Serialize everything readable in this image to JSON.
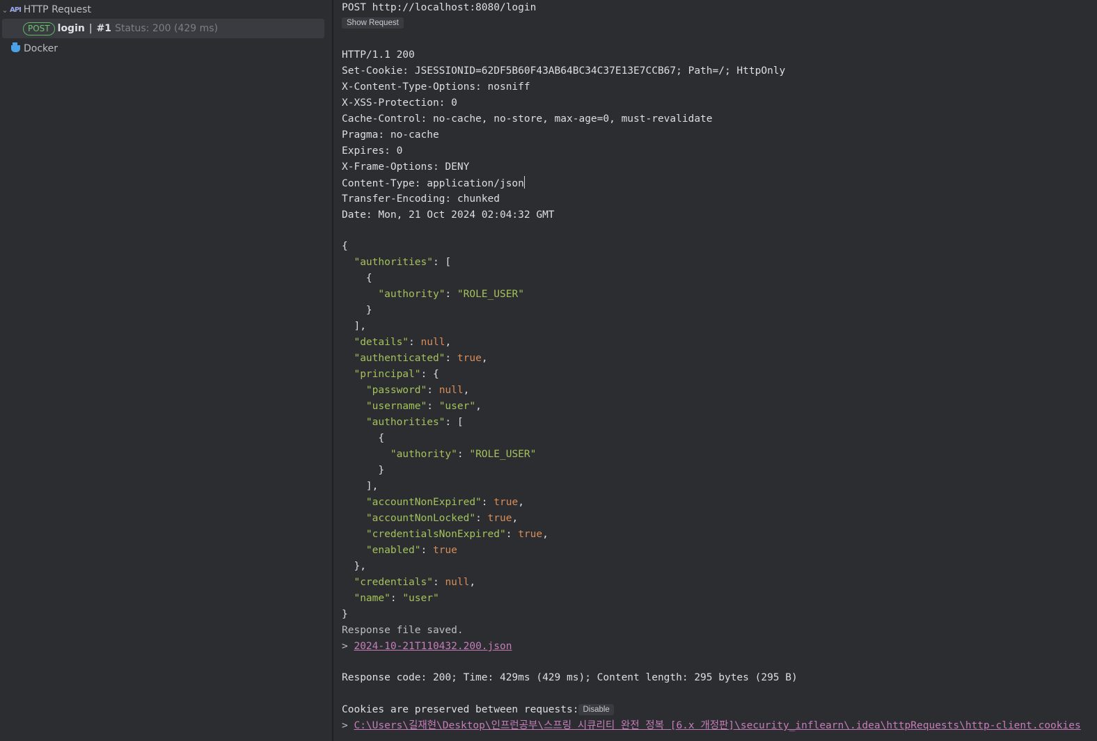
{
  "sidebar": {
    "http_request_label": "HTTP Request",
    "run": {
      "method": "POST",
      "name": "login",
      "separator": "|",
      "number": "#1",
      "status": "Status: 200 (429 ms)"
    },
    "docker_label": "Docker"
  },
  "console": {
    "request_line": "POST http://localhost:8080/login",
    "show_request_label": "Show Request",
    "status_line": "HTTP/1.1 200",
    "headers": [
      "Set-Cookie: JSESSIONID=62DF5B60F43AB64BC34C37E13E7CCB67; Path=/; HttpOnly",
      "X-Content-Type-Options: nosniff",
      "X-XSS-Protection: 0",
      "Cache-Control: no-cache, no-store, max-age=0, must-revalidate",
      "Pragma: no-cache",
      "Expires: 0",
      "X-Frame-Options: DENY",
      "Content-Type: application/json",
      "Transfer-Encoding: chunked",
      "Date: Mon, 21 Oct 2024 02:04:32 GMT"
    ],
    "json": {
      "open_brace": "{",
      "close_brace": "}",
      "authorities_key": "\"authorities\"",
      "authority_key": "\"authority\"",
      "role_user": "\"ROLE_USER\"",
      "details_key": "\"details\"",
      "authenticated_key": "\"authenticated\"",
      "principal_key": "\"principal\"",
      "password_key": "\"password\"",
      "username_key": "\"username\"",
      "user_value": "\"user\"",
      "account_non_expired_key": "\"accountNonExpired\"",
      "account_non_locked_key": "\"accountNonLocked\"",
      "credentials_non_expired_key": "\"credentialsNonExpired\"",
      "enabled_key": "\"enabled\"",
      "credentials_key": "\"credentials\"",
      "name_key": "\"name\"",
      "null_value": "null",
      "true_value": "true"
    },
    "saved_message": "Response file saved.",
    "saved_prefix": "> ",
    "saved_file": "2024-10-21T110432.200.json",
    "summary": "Response code: 200; Time: 429ms (429 ms); Content length: 295 bytes (295 B)",
    "cookies_message": "Cookies are preserved between requests:",
    "disable_label": "Disable",
    "cookie_path_prefix": "> ",
    "cookie_path": "C:\\Users\\길재현\\Desktop\\인프런공부\\스프링 시큐리티 완전 정복 [6.x 개정판]\\security_inflearn\\.idea\\httpRequests\\http-client.cookies"
  }
}
